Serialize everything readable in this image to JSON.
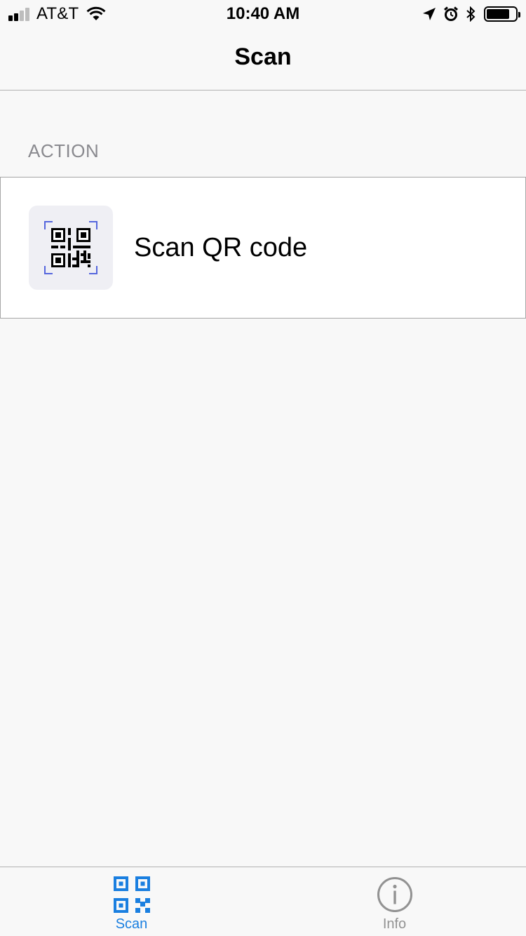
{
  "status_bar": {
    "carrier": "AT&T",
    "time": "10:40 AM",
    "battery_level": 0.8
  },
  "nav": {
    "title": "Scan"
  },
  "section": {
    "header": "ACTION"
  },
  "cell": {
    "label": "Scan QR code",
    "icon": "qr-code-scan-icon"
  },
  "tabs": [
    {
      "label": "Scan",
      "icon": "qr-code-icon",
      "active": true
    },
    {
      "label": "Info",
      "icon": "info-icon",
      "active": false
    }
  ],
  "colors": {
    "accent": "#1a7fe0",
    "inactive": "#929292",
    "scan_frame": "#5566dd",
    "background": "#f8f8f8"
  }
}
